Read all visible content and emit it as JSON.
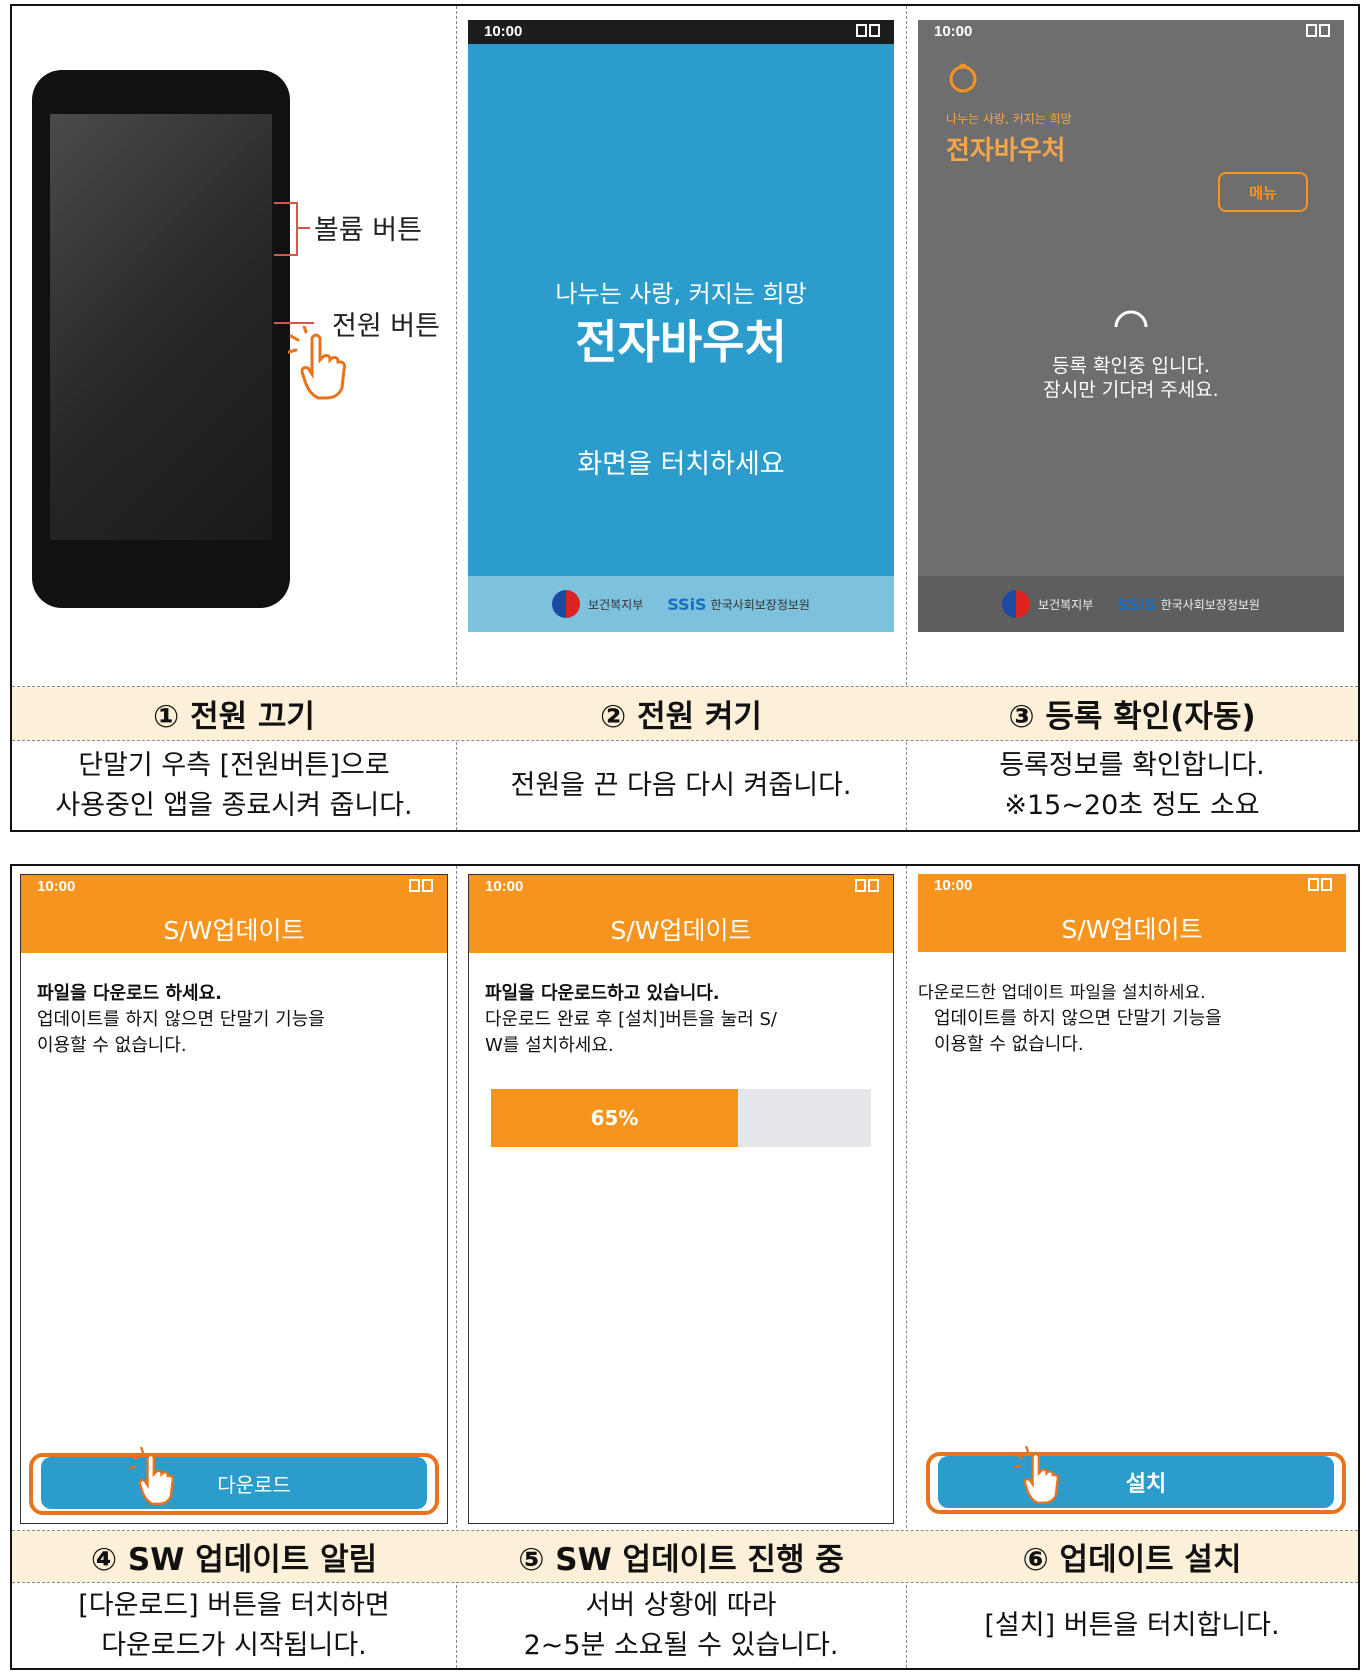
{
  "status_time": "10:00",
  "step1": {
    "title": "① 전원 끄기",
    "desc": "단말기 우측 [전원버튼]으로\n사용중인 앱을 종료시켜 줍니다.",
    "volume_label": "볼륨 버튼",
    "power_label": "전원 버튼"
  },
  "step2": {
    "title": "② 전원 켜기",
    "desc": "전원을 끈 다음 다시 켜줍니다.",
    "slogan": "나누는 사랑, 커지는 희망",
    "app_name": "전자바우처",
    "touch_prompt": "화면을 터치하세요",
    "ministry": "보건복지부",
    "ssis_logo": "SSiS",
    "ssis_name": "한국사회보장정보원"
  },
  "step3": {
    "title": "③ 등록 확인(자동)",
    "desc": "등록정보를 확인합니다.\n※15~20초 정도 소요",
    "slogan": "나누는 사랑, 커지는 희망",
    "app_name": "전자바우처",
    "menu_button": "메뉴",
    "message": "등록 확인중 입니다.\n잠시만 기다려 주세요.",
    "ministry": "보건복지부",
    "ssis_logo": "SSiS",
    "ssis_name": "한국사회보장정보원"
  },
  "step4": {
    "title": "④ SW 업데이트 알림",
    "desc": "[다운로드] 버튼을 터치하면\n다운로드가 시작됩니다.",
    "screen_title": "S/W업데이트",
    "heading": "파일을 다운로드 하세요.",
    "body": "업데이트를 하지 않으면 단말기 기능을\n이용할 수 없습니다.",
    "button": "다운로드"
  },
  "step5": {
    "title": "⑤ SW 업데이트 진행 중",
    "desc": "서버 상황에 따라\n2~5분 소요될 수 있습니다.",
    "screen_title": "S/W업데이트",
    "heading": "파일을 다운로드하고 있습니다.",
    "body": "다운로드 완료 후 [설치]버튼을 눌러 S/\nW를 설치하세요.",
    "progress_label": "65%",
    "progress": 0.65
  },
  "step6": {
    "title": "⑥ 업데이트 설치",
    "desc": "[설치] 버튼을 터치합니다.",
    "screen_title": "S/W업데이트",
    "heading": "다운로드한 업데이트 파일을 설치하세요.",
    "body": "업데이트를 하지 않으면 단말기 기능을\n이용할 수 없습니다.",
    "button": "설치"
  },
  "colors": {
    "accent_orange": "#f7941d",
    "app_blue": "#2b9ccb",
    "title_row_bg": "#fdf0d8"
  }
}
